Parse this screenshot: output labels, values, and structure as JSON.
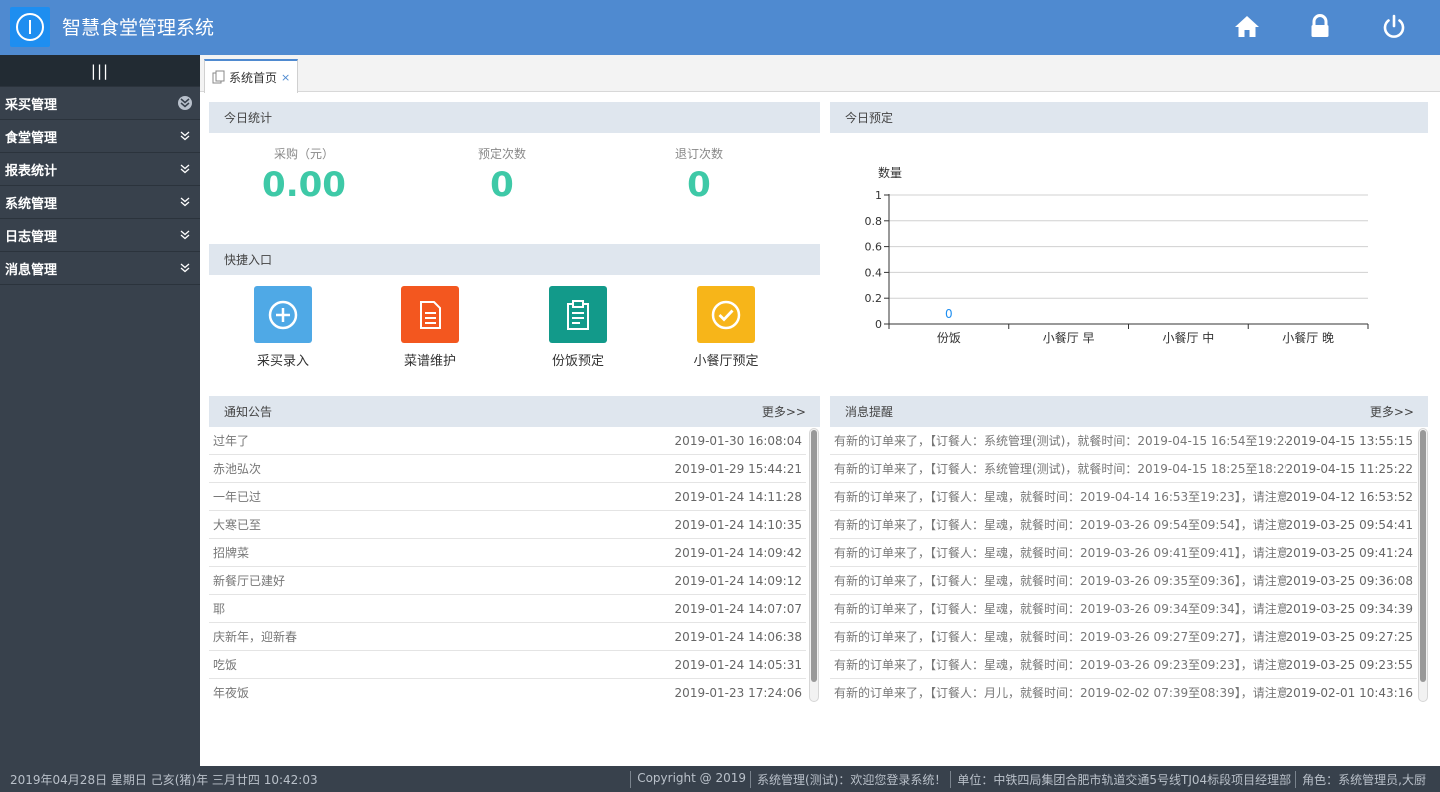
{
  "app": {
    "title": "智慧食堂管理系统"
  },
  "header": {
    "icons": [
      "home-icon",
      "lock-icon",
      "power-icon"
    ]
  },
  "sidebar": {
    "toggle_glyph": "|||",
    "items": [
      {
        "label": "采买管理"
      },
      {
        "label": "食堂管理"
      },
      {
        "label": "报表统计"
      },
      {
        "label": "系统管理"
      },
      {
        "label": "日志管理"
      },
      {
        "label": "消息管理"
      }
    ]
  },
  "tabs": [
    {
      "label": "系统首页",
      "close": "×"
    }
  ],
  "today_stats": {
    "title": "今日统计",
    "items": [
      {
        "label": "采购（元）",
        "value": "0.00"
      },
      {
        "label": "预定次数",
        "value": "0"
      },
      {
        "label": "退订次数",
        "value": "0"
      }
    ]
  },
  "shortcuts": {
    "title": "快捷入口",
    "items": [
      {
        "label": "采买录入",
        "color": "#4fa9e6",
        "icon": "plus-circle-icon"
      },
      {
        "label": "菜谱维护",
        "color": "#f3571f",
        "icon": "document-icon"
      },
      {
        "label": "份饭预定",
        "color": "#129a8a",
        "icon": "clipboard-icon"
      },
      {
        "label": "小餐厅预定",
        "color": "#f7b519",
        "icon": "check-circle-icon"
      }
    ]
  },
  "today_booking": {
    "title": "今日预定"
  },
  "chart_data": {
    "type": "bar",
    "title": "",
    "ylabel": "数量",
    "xlabel": "",
    "ylim": [
      0,
      1
    ],
    "yticks": [
      "0",
      "0.2",
      "0.4",
      "0.6",
      "0.8",
      "1"
    ],
    "categories": [
      "份饭",
      "小餐厅 早",
      "小餐厅 中",
      "小餐厅 晚"
    ],
    "values": [
      0,
      null,
      null,
      null
    ],
    "data_labels": [
      "0",
      "",
      "",
      ""
    ],
    "grid": true,
    "label_color": "#1e8ef0"
  },
  "notices": {
    "title": "通知公告",
    "more": "更多>>",
    "rows": [
      {
        "title": "过年了",
        "date": "2019-01-30 16:08:04"
      },
      {
        "title": "赤池弘次",
        "date": "2019-01-29 15:44:21"
      },
      {
        "title": "一年已过",
        "date": "2019-01-24 14:11:28"
      },
      {
        "title": "大寒已至",
        "date": "2019-01-24 14:10:35"
      },
      {
        "title": "招牌菜",
        "date": "2019-01-24 14:09:42"
      },
      {
        "title": "新餐厅已建好",
        "date": "2019-01-24 14:09:12"
      },
      {
        "title": "耶",
        "date": "2019-01-24 14:07:07"
      },
      {
        "title": "庆新年，迎新春",
        "date": "2019-01-24 14:06:38"
      },
      {
        "title": "吃饭",
        "date": "2019-01-24 14:05:31"
      },
      {
        "title": "年夜饭",
        "date": "2019-01-23 17:24:06"
      }
    ]
  },
  "messages": {
    "title": "消息提醒",
    "more": "更多>>",
    "rows": [
      {
        "text": "有新的订单来了，【订餐人：系统管理(测试)，就餐时间：2019-04-15 16:54至19:24...",
        "date": "2019-04-15 13:55:15"
      },
      {
        "text": "有新的订单来了，【订餐人：系统管理(测试)，就餐时间：2019-04-15 18:25至18:29...",
        "date": "2019-04-15 11:25:22"
      },
      {
        "text": "有新的订单来了，【订餐人：星魂，就餐时间：2019-04-14 16:53至19:23】，请注意...",
        "date": "2019-04-12 16:53:52"
      },
      {
        "text": "有新的订单来了，【订餐人：星魂，就餐时间：2019-03-26 09:54至09:54】，请注意...",
        "date": "2019-03-25 09:54:41"
      },
      {
        "text": "有新的订单来了，【订餐人：星魂，就餐时间：2019-03-26 09:41至09:41】，请注意...",
        "date": "2019-03-25 09:41:24"
      },
      {
        "text": "有新的订单来了，【订餐人：星魂，就餐时间：2019-03-26 09:35至09:36】，请注意...",
        "date": "2019-03-25 09:36:08"
      },
      {
        "text": "有新的订单来了，【订餐人：星魂，就餐时间：2019-03-26 09:34至09:34】，请注意...",
        "date": "2019-03-25 09:34:39"
      },
      {
        "text": "有新的订单来了，【订餐人：星魂，就餐时间：2019-03-26 09:27至09:27】，请注意...",
        "date": "2019-03-25 09:27:25"
      },
      {
        "text": "有新的订单来了，【订餐人：星魂，就餐时间：2019-03-26 09:23至09:23】，请注意...",
        "date": "2019-03-25 09:23:55"
      },
      {
        "text": "有新的订单来了，【订餐人：月儿，就餐时间：2019-02-02 07:39至08:39】，请注意...",
        "date": "2019-02-01 10:43:16"
      }
    ]
  },
  "footer": {
    "datetime": "2019年04月28日 星期日 己亥(猪)年 三月廿四 10:42:03",
    "copyright": "Copyright @ 2019",
    "welcome": "系统管理(测试)：欢迎您登录系统！",
    "unit": "单位：中铁四局集团合肥市轨道交通5号线TJ04标段项目经理部",
    "role": "角色：系统管理员,大厨"
  }
}
